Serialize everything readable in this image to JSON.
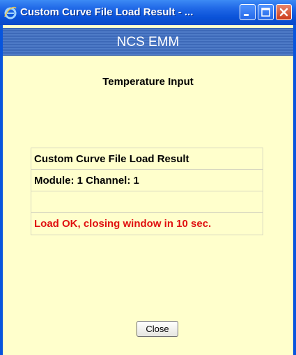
{
  "window": {
    "title": "Custom Curve File Load Result - ...",
    "controls": [
      "minimize-icon",
      "maximize-icon",
      "close-icon"
    ]
  },
  "header": {
    "banner": "NCS EMM",
    "subtitle": "Temperature Input"
  },
  "result": {
    "heading": "Custom Curve File Load Result",
    "module_channel": "Module: 1 Channel: 1",
    "blank": "",
    "status": "Load OK, closing window in 10 sec."
  },
  "actions": {
    "close_label": "Close"
  },
  "colors": {
    "titlebar": "#0a52d8",
    "background": "#ffffcc",
    "banner": "#4e7bc7",
    "status_text": "#e01010"
  }
}
